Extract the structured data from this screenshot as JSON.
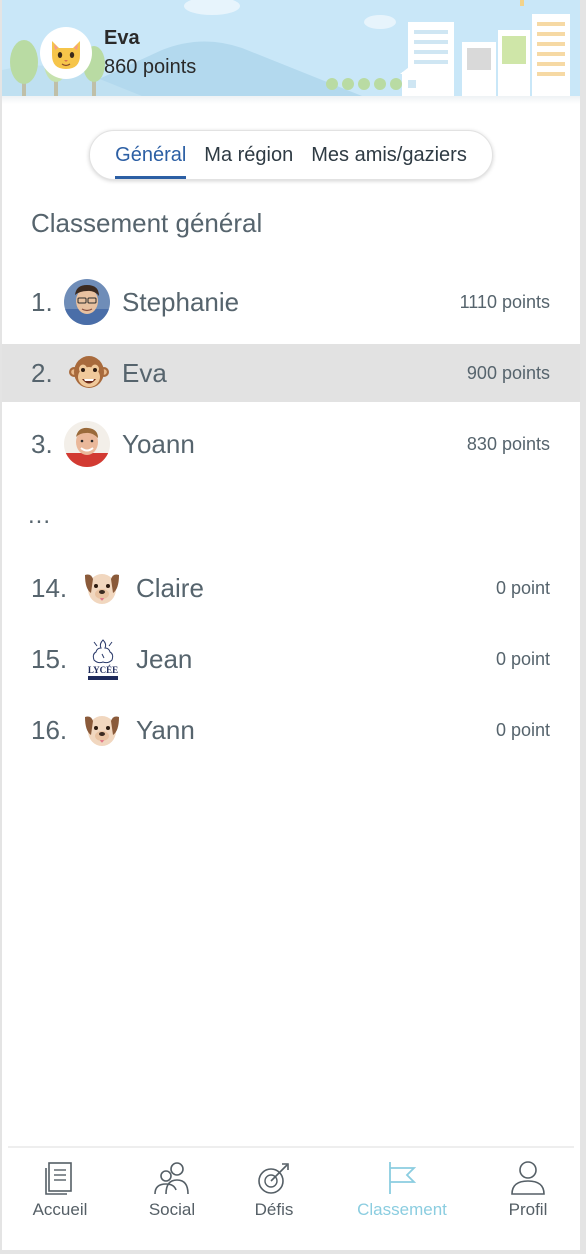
{
  "header": {
    "user_name": "Eva",
    "user_points": "860 points",
    "avatar": "cat-face-icon"
  },
  "tabs": [
    {
      "label": "Général",
      "active": true
    },
    {
      "label": "Ma région",
      "active": false
    },
    {
      "label": "Mes amis/gaziers",
      "active": false
    }
  ],
  "section_title": "Classement général",
  "ranking": [
    {
      "rank": "1.",
      "name": "Stephanie",
      "points": "1110 points",
      "avatar": "photo-avatar"
    },
    {
      "rank": "2.",
      "name": "Eva",
      "points": "900 points",
      "avatar": "monkey-face-icon",
      "highlighted": true
    },
    {
      "rank": "3.",
      "name": "Yoann",
      "points": "830 points",
      "avatar": "photo-avatar"
    },
    {
      "rank": "14.",
      "name": "Claire",
      "points": "0 point",
      "avatar": "dog-face-icon"
    },
    {
      "rank": "15.",
      "name": "Jean",
      "points": "0 point",
      "avatar": "school-logo"
    },
    {
      "rank": "16.",
      "name": "Yann",
      "points": "0 point",
      "avatar": "dog-face-icon"
    }
  ],
  "ellipsis": "...",
  "school_logo_text": "LYCÉE",
  "nav": [
    {
      "label": "Accueil",
      "icon": "document-icon",
      "active": false
    },
    {
      "label": "Social",
      "icon": "users-icon",
      "active": false
    },
    {
      "label": "Défis",
      "icon": "target-icon",
      "active": false
    },
    {
      "label": "Classement",
      "icon": "flag-icon",
      "active": true
    },
    {
      "label": "Profil",
      "icon": "user-icon",
      "active": false
    }
  ],
  "colors": {
    "accent": "#2c5fa4",
    "nav_active": "#8bcde0",
    "highlight_row": "#e2e2e2",
    "header_sky": "#c8e6f7"
  }
}
